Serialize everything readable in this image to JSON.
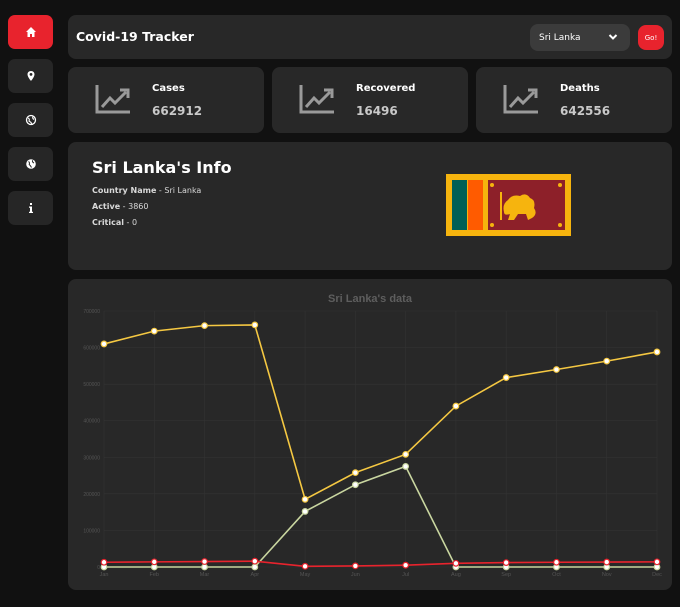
{
  "app": {
    "title": "Covid-19 Tracker"
  },
  "nav": [
    {
      "icon": "home-icon",
      "active": true
    },
    {
      "icon": "map-pin-icon",
      "active": false
    },
    {
      "icon": "globe-outline-icon",
      "active": false
    },
    {
      "icon": "globe-icon",
      "active": false
    },
    {
      "icon": "info-icon",
      "active": false
    }
  ],
  "search": {
    "country": "Sri Lanka",
    "go_label": "Go!"
  },
  "stats": [
    {
      "label": "Cases",
      "value": "662912",
      "icon": "trend-chart-icon"
    },
    {
      "label": "Recovered",
      "value": "16496",
      "icon": "trend-chart-icon"
    },
    {
      "label": "Deaths",
      "value": "642556",
      "icon": "trend-chart-icon"
    }
  ],
  "info": {
    "title": "Sri Lanka's Info",
    "country_label": "Country Name",
    "country_value": "Sri Lanka",
    "active_label": "Active",
    "active_value": "3860",
    "critical_label": "Critical",
    "critical_value": "0"
  },
  "colors": {
    "accent": "#e8232d",
    "cases": "#f5c842",
    "recovered": "#c9d6a0",
    "deaths": "#e8232d"
  },
  "chart_data": {
    "type": "line",
    "title": "Sri Lanka's  data",
    "categories": [
      "Jan",
      "Feb",
      "Mar",
      "Apr",
      "May",
      "Jun",
      "Jul",
      "Aug",
      "Sep",
      "Oct",
      "Nov",
      "Dec"
    ],
    "ylim": [
      0,
      700000
    ],
    "yticks": [
      0,
      100000,
      200000,
      300000,
      400000,
      500000,
      600000,
      700000
    ],
    "grid": true,
    "series": [
      {
        "color": "#f5c842",
        "values": [
          610000,
          645000,
          660000,
          662000,
          185000,
          258000,
          308000,
          440000,
          518000,
          540000,
          563000,
          588000
        ]
      },
      {
        "color": "#c9d6a0",
        "values": [
          0,
          0,
          0,
          0,
          152000,
          225000,
          275000,
          0,
          0,
          0,
          0,
          0
        ]
      },
      {
        "color": "#e8232d",
        "values": [
          13000,
          14000,
          15000,
          16000,
          2000,
          3000,
          5000,
          10000,
          12000,
          13000,
          13500,
          14000
        ]
      }
    ]
  }
}
